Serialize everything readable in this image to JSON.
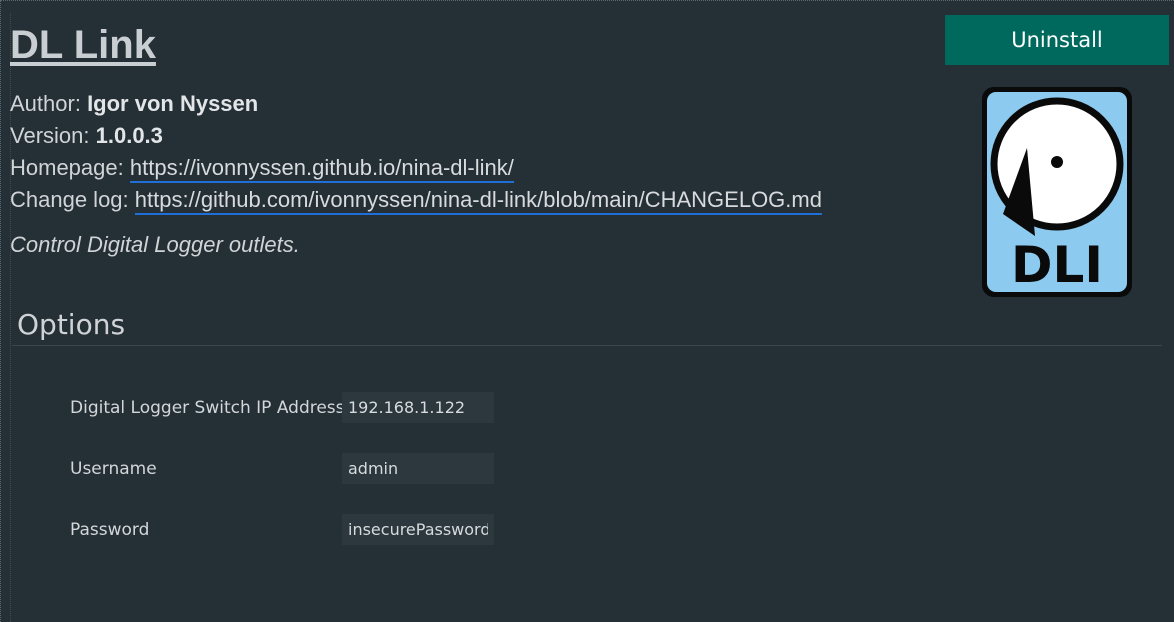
{
  "plugin": {
    "name": "DL Link",
    "uninstall_label": "Uninstall",
    "author_label": "Author:",
    "author": "Igor von Nyssen",
    "version_label": "Version:",
    "version": "1.0.0.3",
    "homepage_label": "Homepage:",
    "homepage": "https://ivonnyssen.github.io/nina-dl-link/",
    "changelog_label": "Change log:",
    "changelog": "https://github.com/ivonnyssen/nina-dl-link/blob/main/CHANGELOG.md",
    "description": "Control Digital Logger outlets.",
    "logo_text": "DLI"
  },
  "options": {
    "title": "Options",
    "fields": [
      {
        "label": "Digital Logger Switch IP Address",
        "value": "192.168.1.122"
      },
      {
        "label": "Username",
        "value": "admin"
      },
      {
        "label": "Password",
        "value": "insecurePassword"
      }
    ]
  },
  "colors": {
    "background": "#252f36",
    "accent": "#00695e",
    "link_underline": "#1f6fd6"
  }
}
